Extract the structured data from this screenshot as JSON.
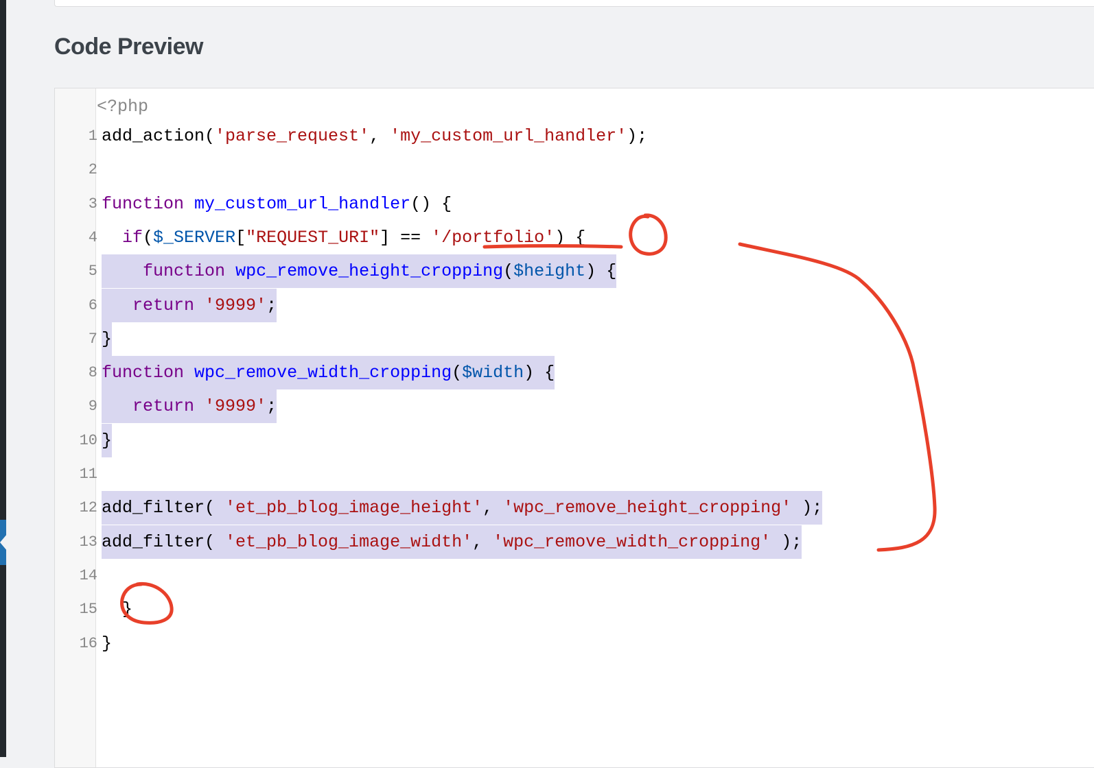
{
  "section_title": "Code Preview",
  "colors": {
    "keyword": "#770088",
    "function_name": "#0000ff",
    "string": "#aa1111",
    "variable": "#0055aa",
    "selection": "#d9d7f0",
    "annotation": "#e8402a"
  },
  "code": {
    "php_open": "<?php",
    "lines": [
      {
        "number": "1",
        "selected": false,
        "tokens": [
          [
            "",
            "add_action("
          ],
          [
            "str",
            "'parse_request'"
          ],
          [
            "",
            ", "
          ],
          [
            "str",
            "'my_custom_url_handler'"
          ],
          [
            "",
            ");"
          ]
        ]
      },
      {
        "number": "2",
        "selected": false,
        "tokens": []
      },
      {
        "number": "3",
        "selected": false,
        "tokens": [
          [
            "kw",
            "function"
          ],
          [
            "",
            " "
          ],
          [
            "def",
            "my_custom_url_handler"
          ],
          [
            "",
            "() {"
          ]
        ]
      },
      {
        "number": "4",
        "selected": false,
        "tokens": [
          [
            "",
            "  "
          ],
          [
            "kw",
            "if"
          ],
          [
            "",
            "("
          ],
          [
            "var",
            "$_SERVER"
          ],
          [
            "",
            "["
          ],
          [
            "str",
            "\"REQUEST_URI\""
          ],
          [
            "",
            "] == "
          ],
          [
            "str",
            "'/portfolio'"
          ],
          [
            "",
            ") {"
          ]
        ]
      },
      {
        "number": "5",
        "selected": true,
        "tokens": [
          [
            "",
            "    "
          ],
          [
            "kw",
            "function"
          ],
          [
            "",
            " "
          ],
          [
            "def",
            "wpc_remove_height_cropping"
          ],
          [
            "",
            "("
          ],
          [
            "var",
            "$height"
          ],
          [
            "",
            ") {"
          ]
        ]
      },
      {
        "number": "6",
        "selected": true,
        "tokens": [
          [
            "",
            "   "
          ],
          [
            "kw",
            "return"
          ],
          [
            "",
            " "
          ],
          [
            "str",
            "'9999'"
          ],
          [
            "",
            ";"
          ]
        ]
      },
      {
        "number": "7",
        "selected": true,
        "tokens": [
          [
            "",
            "}"
          ]
        ]
      },
      {
        "number": "8",
        "selected": true,
        "tokens": [
          [
            "kw",
            "function"
          ],
          [
            "",
            " "
          ],
          [
            "def",
            "wpc_remove_width_cropping"
          ],
          [
            "",
            "("
          ],
          [
            "var",
            "$width"
          ],
          [
            "",
            ") {"
          ]
        ]
      },
      {
        "number": "9",
        "selected": true,
        "tokens": [
          [
            "",
            "   "
          ],
          [
            "kw",
            "return"
          ],
          [
            "",
            " "
          ],
          [
            "str",
            "'9999'"
          ],
          [
            "",
            ";"
          ]
        ]
      },
      {
        "number": "10",
        "selected": true,
        "tokens": [
          [
            "",
            "}"
          ]
        ]
      },
      {
        "number": "11",
        "selected": false,
        "tokens": []
      },
      {
        "number": "12",
        "selected": true,
        "tokens": [
          [
            "",
            "add_filter( "
          ],
          [
            "str",
            "'et_pb_blog_image_height'"
          ],
          [
            "",
            ", "
          ],
          [
            "str",
            "'wpc_remove_height_cropping'"
          ],
          [
            "",
            " );"
          ]
        ]
      },
      {
        "number": "13",
        "selected": true,
        "tokens": [
          [
            "",
            "add_filter( "
          ],
          [
            "str",
            "'et_pb_blog_image_width'"
          ],
          [
            "",
            ", "
          ],
          [
            "str",
            "'wpc_remove_width_cropping'"
          ],
          [
            "",
            " );"
          ]
        ]
      },
      {
        "number": "14",
        "selected": false,
        "tokens": []
      },
      {
        "number": "15",
        "selected": false,
        "tokens": [
          [
            "",
            "  }"
          ]
        ]
      },
      {
        "number": "16",
        "selected": false,
        "tokens": [
          [
            "",
            "}"
          ]
        ]
      }
    ]
  }
}
